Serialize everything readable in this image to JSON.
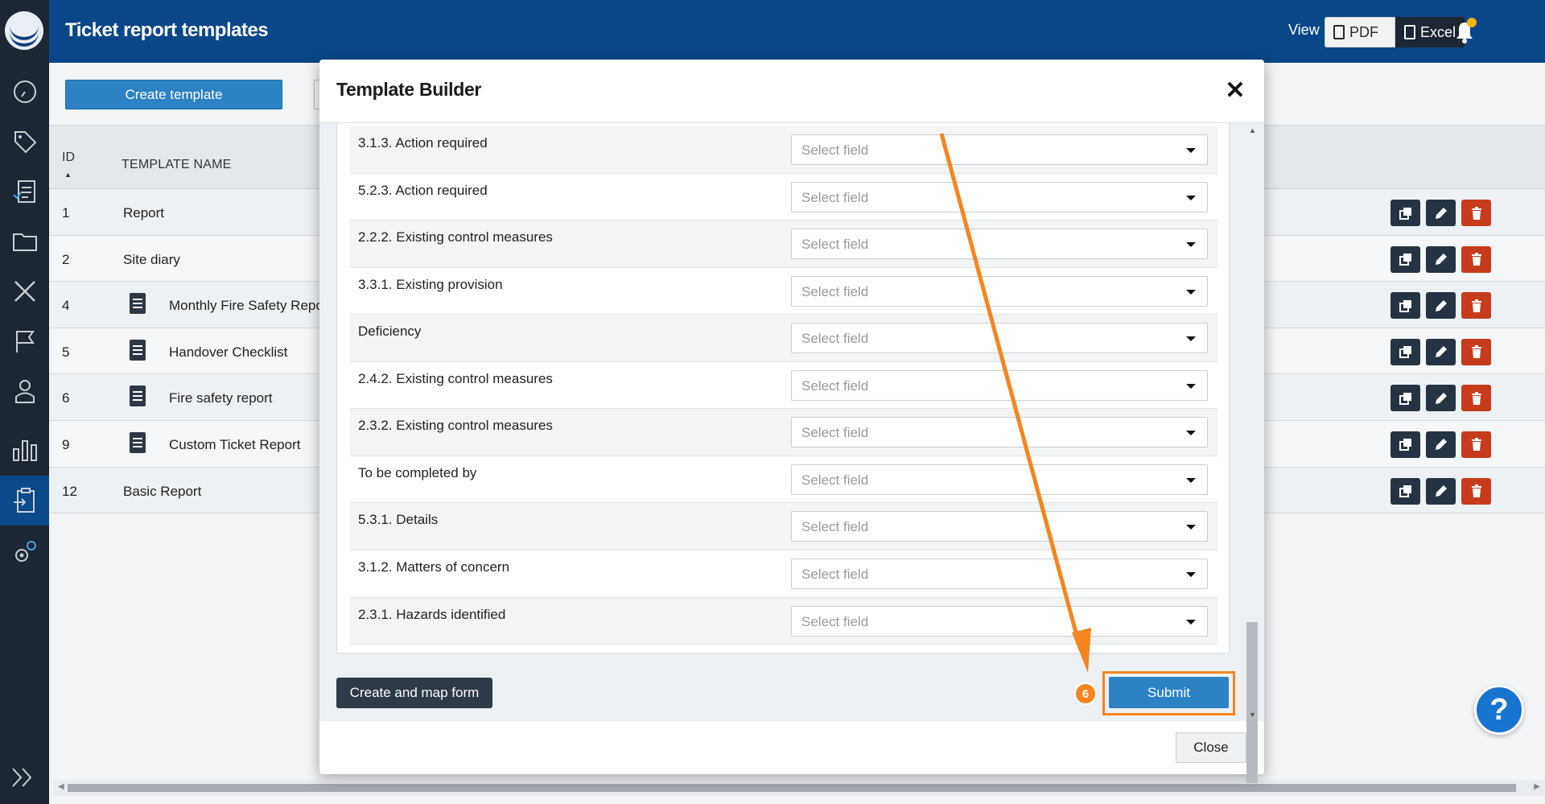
{
  "header": {
    "title": "Ticket report templates",
    "view_label": "View",
    "pdf_label": "PDF",
    "excel_label": "Excel"
  },
  "toolbar": {
    "create_template_label": "Create template"
  },
  "table": {
    "headers": {
      "id": "ID",
      "name": "TEMPLATE NAME"
    },
    "rows": [
      {
        "id": "1",
        "name": "Report",
        "icon": false
      },
      {
        "id": "2",
        "name": "Site diary",
        "icon": false
      },
      {
        "id": "4",
        "name": "Monthly Fire Safety Repo",
        "icon": true
      },
      {
        "id": "5",
        "name": "Handover Checklist",
        "icon": true
      },
      {
        "id": "6",
        "name": "Fire safety report",
        "icon": true
      },
      {
        "id": "9",
        "name": "Custom Ticket Report",
        "icon": true
      },
      {
        "id": "12",
        "name": "Basic Report",
        "icon": false
      }
    ]
  },
  "modal": {
    "title": "Template Builder",
    "select_placeholder": "Select field",
    "fields": [
      "3.1.3. Action required",
      "5.2.3. Action required",
      "2.2.2. Existing control measures",
      "3.3.1. Existing provision",
      "Deficiency",
      "2.4.2. Existing control measures",
      "2.3.2. Existing control measures",
      "To be completed by",
      "5.3.1. Details",
      "3.1.2. Matters of concern",
      "2.3.1. Hazards identified"
    ],
    "create_map_label": "Create and map form",
    "submit_label": "Submit",
    "step_number": "6",
    "close_label": "Close"
  },
  "help": {
    "label": "?"
  },
  "colors": {
    "header": "#0a4788",
    "sidebar": "#1d2733",
    "primary": "#2d82c4",
    "highlight": "#f5851f",
    "danger": "#c63b1c"
  }
}
